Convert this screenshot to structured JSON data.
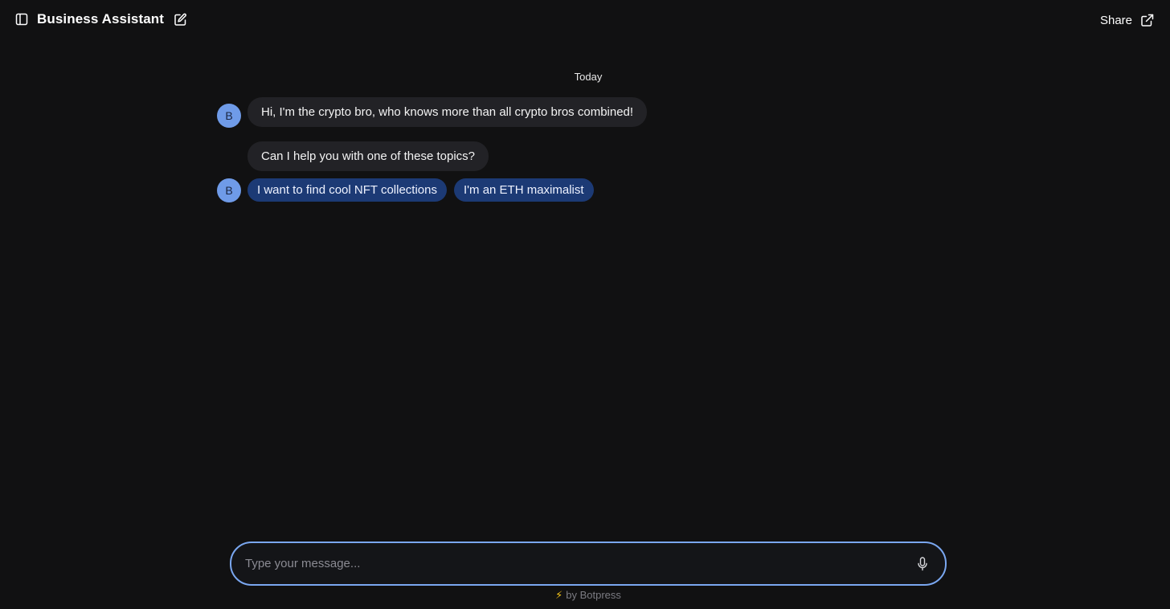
{
  "header": {
    "title": "Business Assistant",
    "share_label": "Share"
  },
  "chat": {
    "date_divider": "Today",
    "bot_avatar_initial": "B",
    "messages": [
      "Hi, I'm the crypto bro, who knows more than all crypto bros combined!",
      "Can I help you with one of these topics?"
    ],
    "choices": [
      "I want to find cool NFT collections",
      "I'm an ETH maximalist"
    ]
  },
  "composer": {
    "placeholder": "Type your message...",
    "value": ""
  },
  "footer": {
    "bolt_icon": "⚡",
    "branding": "by Botpress"
  },
  "colors": {
    "background": "#111112",
    "accent": "#7aa7f0",
    "avatar": "#6f9be8",
    "choice_button": "#1c3a75",
    "bubble": "#222226"
  },
  "icons": {
    "sidebar_toggle": "sidebar-toggle-icon",
    "edit": "edit-icon",
    "share": "external-link-icon",
    "mic": "microphone-icon"
  }
}
